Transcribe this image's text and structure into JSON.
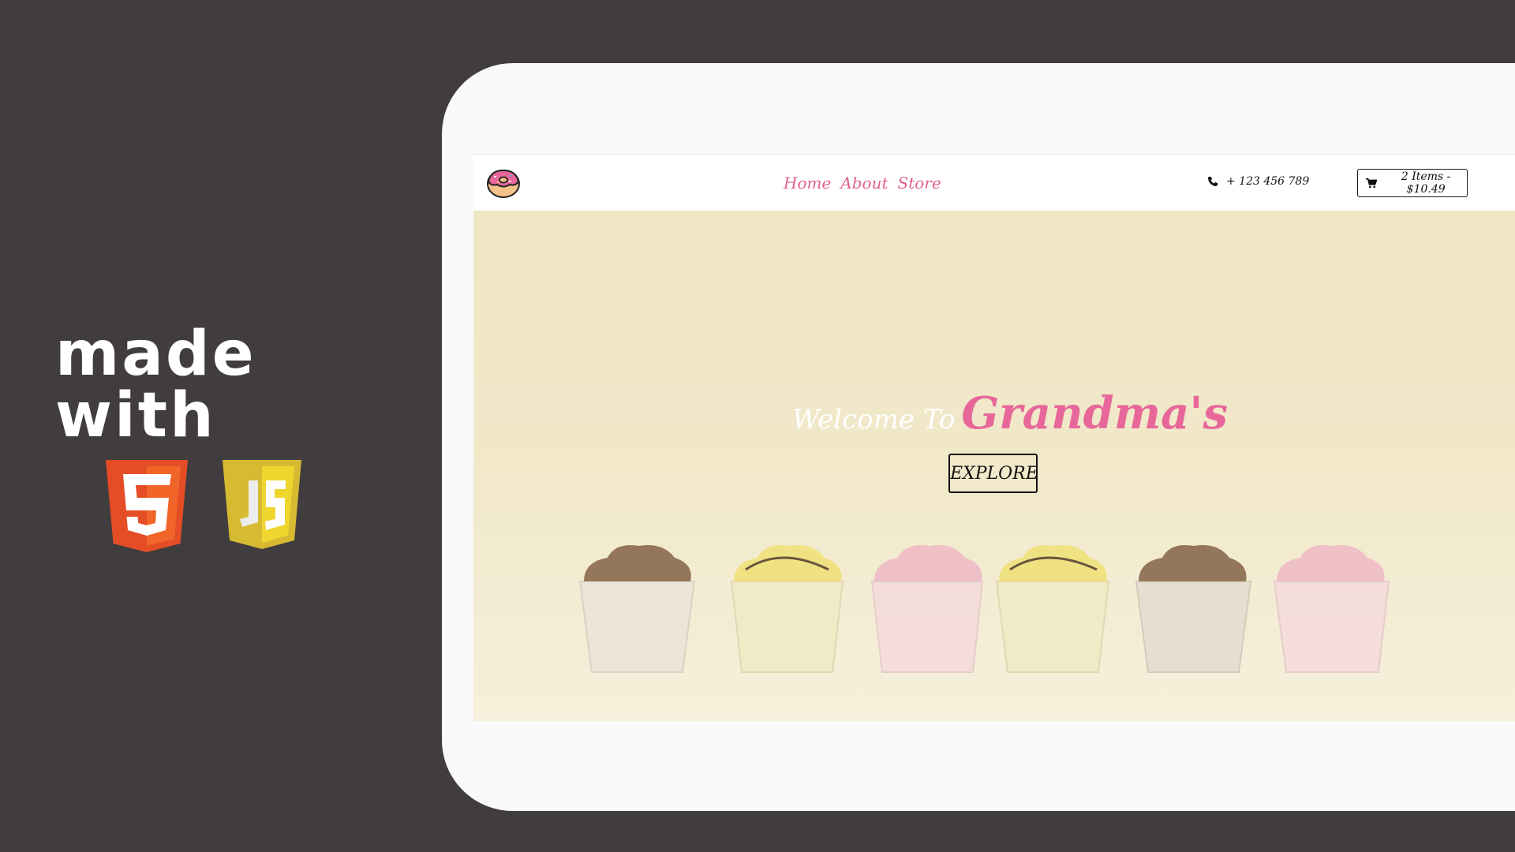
{
  "promo": {
    "tagline": "made with",
    "badges": [
      "html5-logo",
      "javascript-logo"
    ]
  },
  "site": {
    "nav": {
      "logo_icon": "donut-icon",
      "links": [
        {
          "label": "Home"
        },
        {
          "label": "About"
        },
        {
          "label": "Store"
        }
      ],
      "phone_icon": "phone-icon",
      "phone": "+ 123 456 789",
      "cart_icon": "shopping-cart-icon",
      "cart_label": "2 Items - $10.49"
    },
    "hero": {
      "welcome": "Welcome To",
      "brand": "Grandma's",
      "button_label": "EXPLORE"
    }
  },
  "colors": {
    "background": "#413d3e",
    "accent_pink": "#e8679a",
    "frame": "#f9f9f9"
  }
}
